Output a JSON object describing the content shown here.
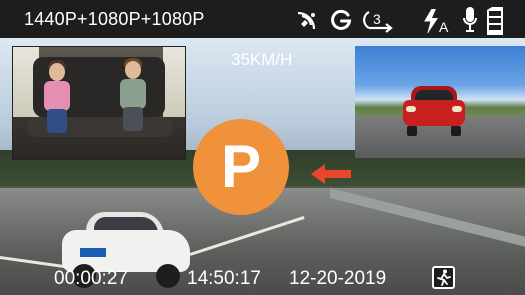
{
  "status_bar": {
    "resolution": "1440P+1080P+1080P",
    "icons": [
      "gps-signal-icon",
      "g-sensor-icon",
      "loop-recording-icon",
      "auto-flash-icon",
      "microphone-icon",
      "sd-card-icon"
    ],
    "loop_minutes": "3",
    "flash_mode": "A"
  },
  "overlay": {
    "speed": "35KM/H",
    "parking_label": "P",
    "elapsed_time": "00:00:27",
    "clock": "14:50:17",
    "date": "12-20-2019"
  },
  "colors": {
    "parking_badge": "#f0923c",
    "arrow": "#e8472b",
    "text": "#ffffff",
    "status_bar_bg": "#1d1d1d"
  }
}
